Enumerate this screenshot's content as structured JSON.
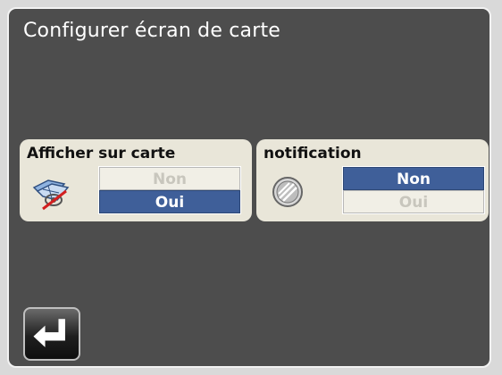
{
  "header": {
    "title": "Configurer écran de carte"
  },
  "settings": [
    {
      "label": "Afficher sur carte",
      "icon": "map-view-icon",
      "options": [
        "Non",
        "Oui"
      ],
      "selected": "Oui"
    },
    {
      "label": "notification",
      "icon": "alert-disc-icon",
      "options": [
        "Non",
        "Oui"
      ],
      "selected": "Non"
    }
  ],
  "footer": {
    "back_icon": "return-arrow-icon"
  },
  "colors": {
    "background": "#4d4d4d",
    "panel": "#e9e6d9",
    "selected": "#3f5f99"
  }
}
